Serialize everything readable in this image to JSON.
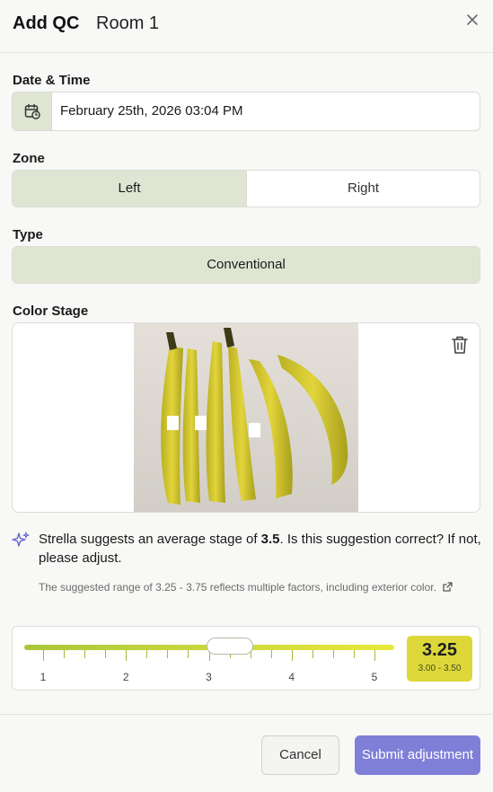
{
  "header": {
    "title": "Add QC",
    "subtitle": "Room 1"
  },
  "date_time": {
    "label": "Date & Time",
    "value": "February 25th, 2026 03:04 PM",
    "icon": "calendar-clock-icon"
  },
  "zone": {
    "label": "Zone",
    "options": [
      "Left",
      "Right"
    ],
    "selected": "Left"
  },
  "type": {
    "label": "Type",
    "value": "Conventional"
  },
  "color_stage": {
    "label": "Color Stage",
    "photo_alt": "bananas photo",
    "suggestion_prefix": "Strella suggests an average stage of ",
    "suggestion_value": "3.5",
    "suggestion_suffix": ". Is this suggestion correct? If not, please adjust.",
    "note": "The suggested range of 3.25 - 3.75 reflects multiple factors, including exterior color."
  },
  "slider": {
    "min": 1,
    "max": 5,
    "tick_labels": [
      "1",
      "2",
      "3",
      "4",
      "5"
    ],
    "value": 3.25,
    "value_label": "3.25",
    "range_label": "3.00 - 3.50"
  },
  "footer": {
    "cancel_label": "Cancel",
    "submit_label": "Submit adjustment"
  },
  "colors": {
    "accent_green": "#dfe5d3",
    "badge_yellow": "#dcd83a",
    "submit_purple": "#7f7fd8"
  }
}
